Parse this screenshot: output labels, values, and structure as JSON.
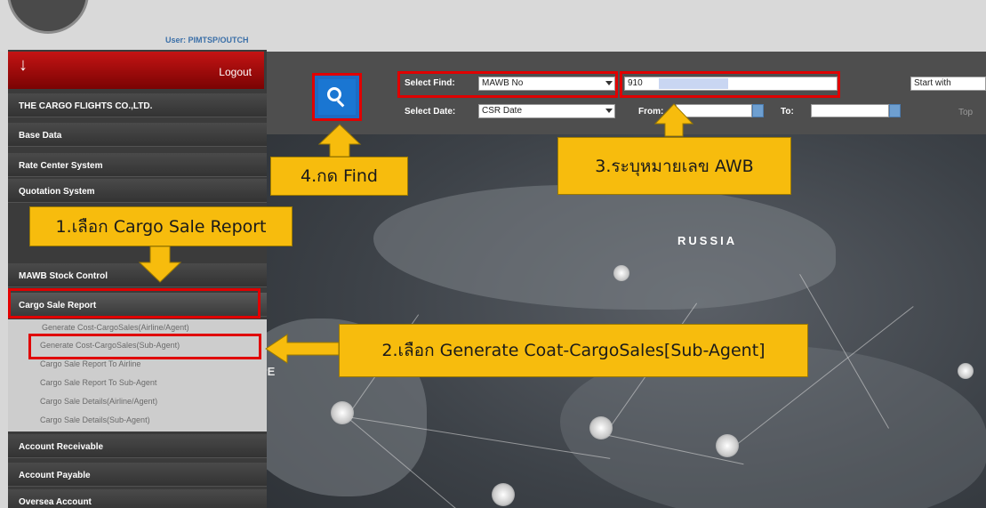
{
  "header": {
    "user_label": "User: PIMTSP/OUTCH"
  },
  "sidebar": {
    "logout_label": "Logout",
    "company": "THE CARGO FLIGHTS CO.,LTD.",
    "items": [
      "Base Data",
      "Rate Center System",
      "Quotation System",
      "MAWB Stock Control",
      "Cargo Sale Report",
      "Account Receivable",
      "Account Payable",
      "Oversea Account"
    ],
    "submenu": [
      "Generate Cost-CargoSales(Airline/Agent)",
      "Generate Cost-CargoSales(Sub-Agent)",
      "Cargo Sale Report To Airline",
      "Cargo Sale Report To Sub-Agent",
      "Cargo Sale Details(Airline/Agent)",
      "Cargo Sale Details(Sub-Agent)"
    ]
  },
  "toolbar": {
    "select_find_label": "Select Find:",
    "select_find_value": "MAWB No",
    "awb_value": "910",
    "start_with_value": "Start with",
    "select_date_label": "Select Date:",
    "select_date_value": "CSR Date",
    "from_label": "From:",
    "to_label": "To:",
    "top_label": "Top"
  },
  "map": {
    "russia_label": "RUSSIA",
    "pe_label": "PE"
  },
  "callouts": {
    "step1": "1.เลือก Cargo Sale Report",
    "step2": "2.เลือก Generate Coat-CargoSales[Sub-Agent]",
    "step3": "3.ระบุหมายเลข AWB",
    "step4": "4.กด Find"
  },
  "colors": {
    "highlight": "#e00000",
    "callout": "#f7bc0d",
    "find_button": "#1d6bc3",
    "logout": "#c41414"
  },
  "icons": {
    "find": "search-icon",
    "logout": "down-arrow-icon",
    "calendar": "calendar-icon"
  }
}
